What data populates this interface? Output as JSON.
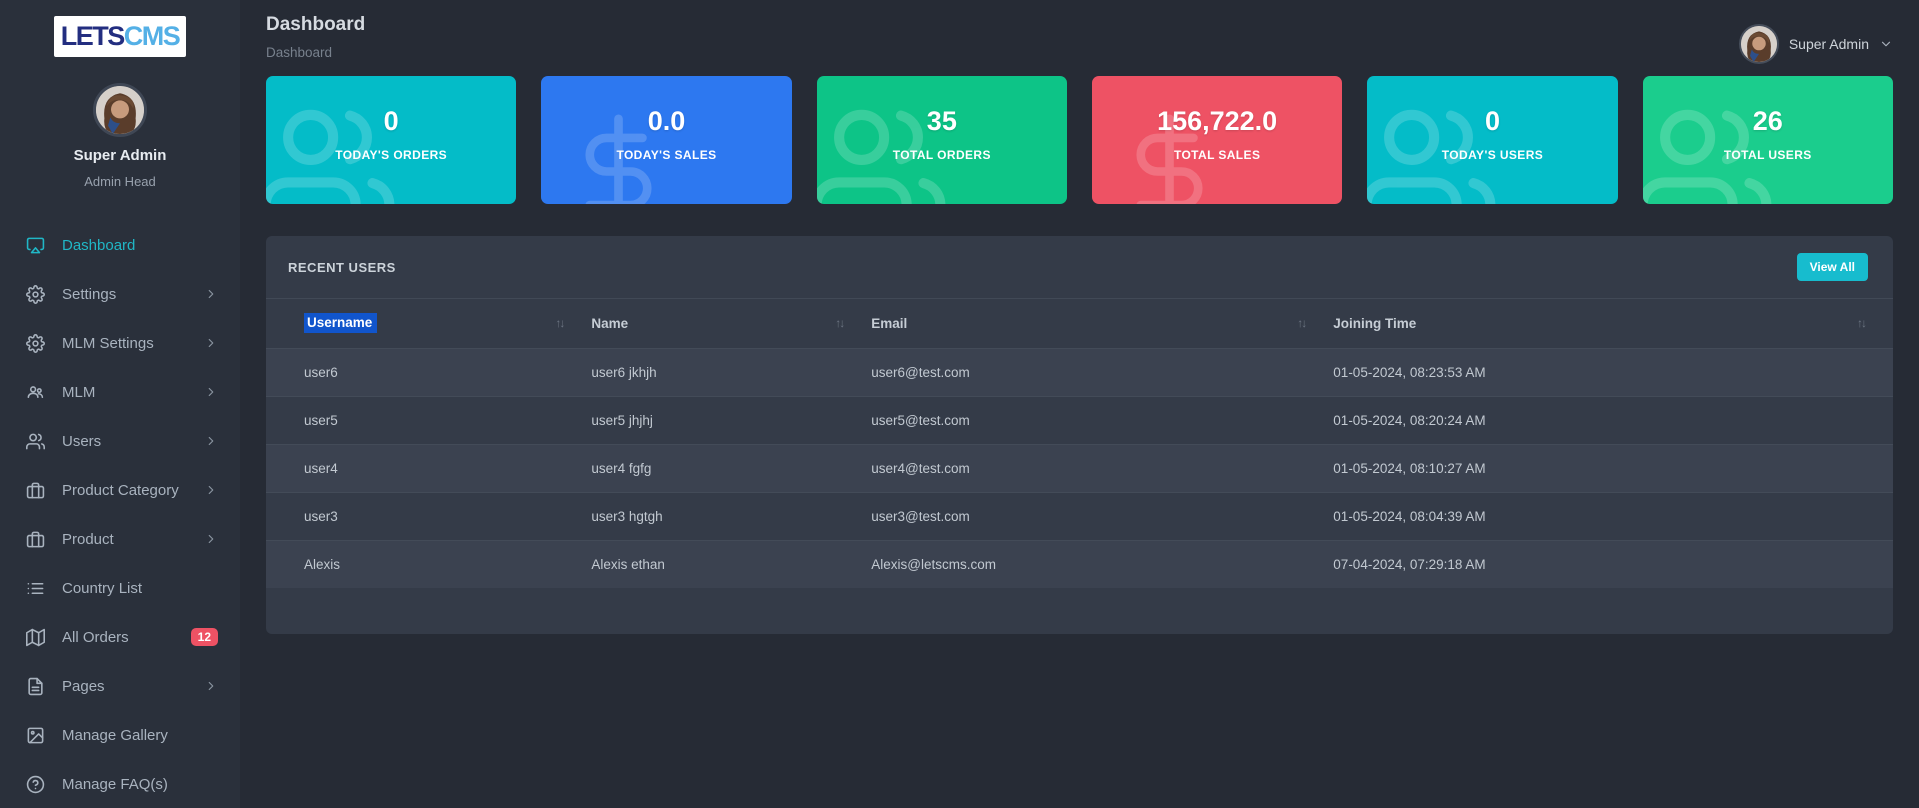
{
  "brand": {
    "logo_lets": "LETS",
    "logo_cms": "CMS"
  },
  "sidebar": {
    "user": {
      "name": "Super Admin",
      "role": "Admin Head"
    },
    "items": [
      {
        "label": "Dashboard",
        "icon": "airplay-icon",
        "active": true,
        "chevron": false
      },
      {
        "label": "Settings",
        "icon": "gear-icon",
        "active": false,
        "chevron": true
      },
      {
        "label": "MLM Settings",
        "icon": "gear-icon",
        "active": false,
        "chevron": true
      },
      {
        "label": "MLM",
        "icon": "group-icon",
        "active": false,
        "chevron": true
      },
      {
        "label": "Users",
        "icon": "users-icon",
        "active": false,
        "chevron": true
      },
      {
        "label": "Product Category",
        "icon": "briefcase-icon",
        "active": false,
        "chevron": true
      },
      {
        "label": "Product",
        "icon": "briefcase-icon",
        "active": false,
        "chevron": true
      },
      {
        "label": "Country List",
        "icon": "list-icon",
        "active": false,
        "chevron": false
      },
      {
        "label": "All Orders",
        "icon": "map-icon",
        "active": false,
        "chevron": false,
        "badge": "12"
      },
      {
        "label": "Pages",
        "icon": "file-icon",
        "active": false,
        "chevron": true
      },
      {
        "label": "Manage Gallery",
        "icon": "image-icon",
        "active": false,
        "chevron": false
      },
      {
        "label": "Manage FAQ(s)",
        "icon": "help-icon",
        "active": false,
        "chevron": false
      }
    ]
  },
  "header": {
    "title": "Dashboard",
    "breadcrumb": "Dashboard",
    "user_name": "Super Admin"
  },
  "stats": [
    {
      "value": "0",
      "label": "TODAY'S ORDERS",
      "color": "#04bcc8",
      "icon": "users-icon"
    },
    {
      "value": "0.0",
      "label": "TODAY'S SALES",
      "color": "#2d78f0",
      "icon": "dollar-icon"
    },
    {
      "value": "35",
      "label": "TOTAL ORDERS",
      "color": "#0dc487",
      "icon": "users-icon"
    },
    {
      "value": "156,722.0",
      "label": "TOTAL SALES",
      "color": "#ee5264",
      "icon": "dollar-icon"
    },
    {
      "value": "0",
      "label": "TODAY'S USERS",
      "color": "#04bcc8",
      "icon": "users-icon"
    },
    {
      "value": "26",
      "label": "TOTAL USERS",
      "color": "#1bcd8d",
      "icon": "users-icon"
    }
  ],
  "recent_users": {
    "title": "RECENT USERS",
    "view_all_label": "View All",
    "columns": [
      "Username",
      "Name",
      "Email",
      "Joining Time"
    ],
    "rows": [
      {
        "username": "user6",
        "name": "user6 jkhjh",
        "email": "user6@test.com",
        "joining_time": "01-05-2024, 08:23:53 AM"
      },
      {
        "username": "user5",
        "name": "user5 jhjhj",
        "email": "user5@test.com",
        "joining_time": "01-05-2024, 08:20:24 AM"
      },
      {
        "username": "user4",
        "name": "user4 fgfg",
        "email": "user4@test.com",
        "joining_time": "01-05-2024, 08:10:27 AM"
      },
      {
        "username": "user3",
        "name": "user3 hgtgh",
        "email": "user3@test.com",
        "joining_time": "01-05-2024, 08:04:39 AM"
      },
      {
        "username": "Alexis",
        "name": "Alexis ethan",
        "email": "Alexis@letscms.com",
        "joining_time": "07-04-2024, 07:29:18 AM"
      }
    ]
  },
  "colors": {
    "accent_cyan": "#04bcc8",
    "accent_blue": "#2d78f0",
    "accent_green": "#0dc487",
    "accent_green_light": "#1bcd8d",
    "accent_red": "#ee5264",
    "button_cyan": "#17bcce",
    "selection_blue": "#1155cc",
    "sidebar_bg": "#2a303b",
    "main_bg": "#262b35",
    "panel_bg": "#343b48"
  }
}
